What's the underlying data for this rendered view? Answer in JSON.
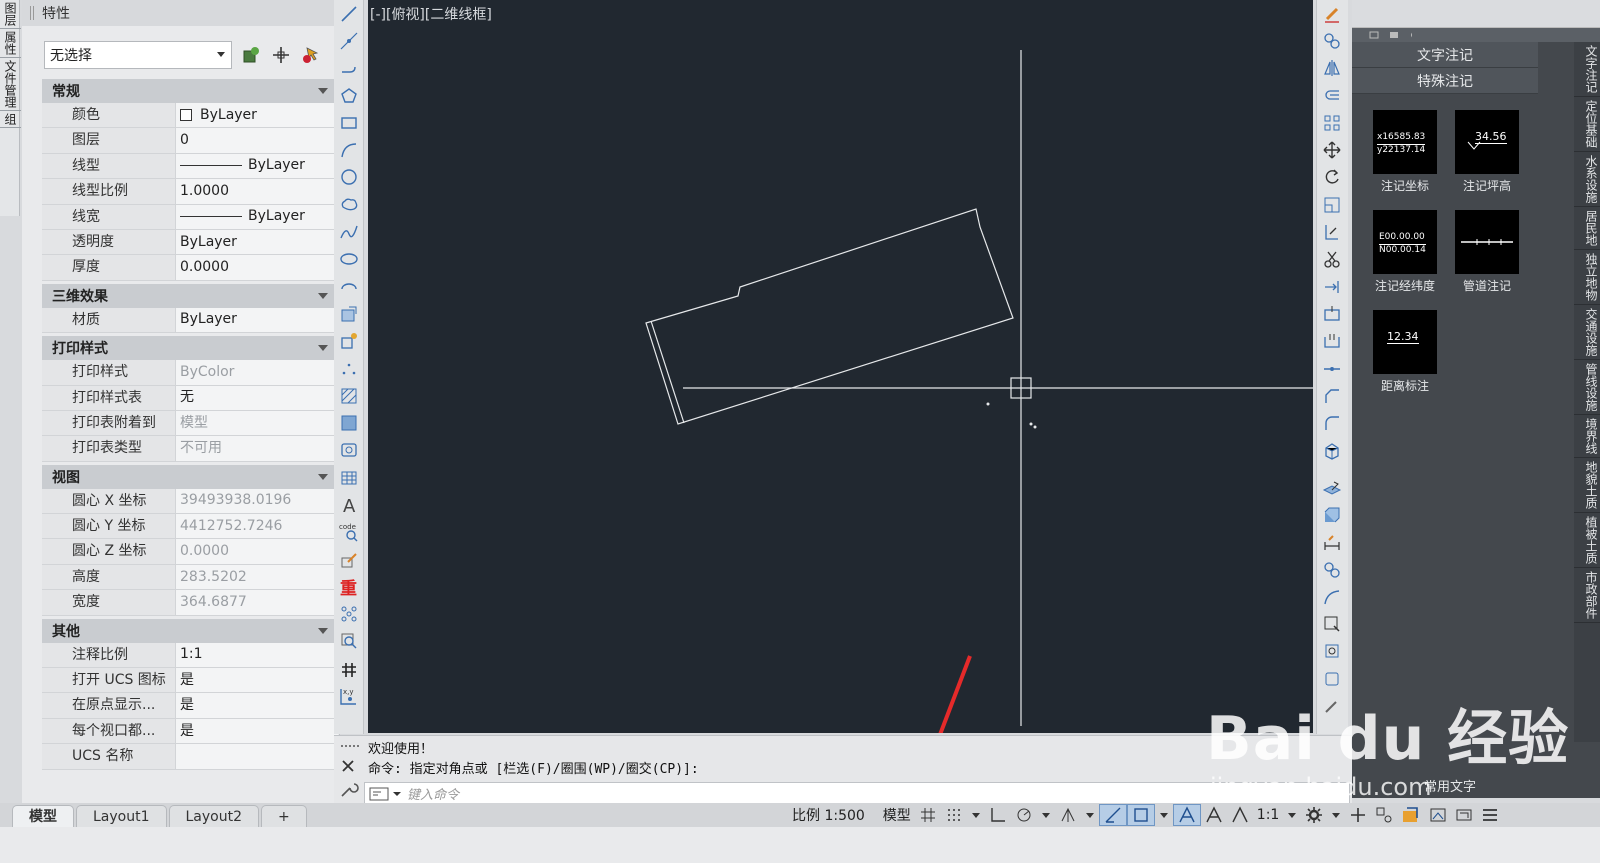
{
  "left_strip": {
    "tabs": [
      "图层",
      "属性",
      "文件管理",
      "组"
    ]
  },
  "properties": {
    "title": "特性",
    "selection": "无选择",
    "sections": [
      {
        "name": "常规",
        "rows": [
          {
            "label": "颜色",
            "value": "ByLayer",
            "kind": "color"
          },
          {
            "label": "图层",
            "value": "0"
          },
          {
            "label": "线型",
            "value": "ByLayer",
            "kind": "line"
          },
          {
            "label": "线型比例",
            "value": "1.0000"
          },
          {
            "label": "线宽",
            "value": "ByLayer",
            "kind": "line"
          },
          {
            "label": "透明度",
            "value": "ByLayer"
          },
          {
            "label": "厚度",
            "value": "0.0000"
          }
        ]
      },
      {
        "name": "三维效果",
        "rows": [
          {
            "label": "材质",
            "value": "ByLayer"
          }
        ]
      },
      {
        "name": "打印样式",
        "rows": [
          {
            "label": "打印样式",
            "value": "ByColor",
            "gray": true
          },
          {
            "label": "打印样式表",
            "value": "无"
          },
          {
            "label": "打印表附着到",
            "value": "模型",
            "gray": true
          },
          {
            "label": "打印表类型",
            "value": "不可用",
            "gray": true
          }
        ]
      },
      {
        "name": "视图",
        "rows": [
          {
            "label": "圆心 X 坐标",
            "value": "39493938.0196",
            "gray": true
          },
          {
            "label": "圆心 Y 坐标",
            "value": "4412752.7246",
            "gray": true
          },
          {
            "label": "圆心 Z 坐标",
            "value": "0.0000",
            "gray": true
          },
          {
            "label": "高度",
            "value": "283.5202",
            "gray": true
          },
          {
            "label": "宽度",
            "value": "364.6877",
            "gray": true
          }
        ]
      },
      {
        "name": "其他",
        "rows": [
          {
            "label": "注释比例",
            "value": "1:1"
          },
          {
            "label": "打开 UCS 图标",
            "value": "是"
          },
          {
            "label": "在原点显示...",
            "value": "是"
          },
          {
            "label": "每个视口都...",
            "value": "是"
          },
          {
            "label": "UCS 名称",
            "value": ""
          }
        ]
      }
    ]
  },
  "viewport": {
    "label": "[-][俯视][二维线框]"
  },
  "palette": {
    "heads": [
      "文字注记",
      "特殊注记"
    ],
    "tools": [
      {
        "label": "注记坐标",
        "thumb1": "x16585.83",
        "thumb2": "y22137.14"
      },
      {
        "label": "注记坪高",
        "thumb1": "34.56",
        "thumb2": ""
      },
      {
        "label": "注记经纬度",
        "thumb1": "E00.00.00",
        "thumb2": "N00.00.14"
      },
      {
        "label": "管道注记",
        "thumb1": "",
        "thumb2": ""
      },
      {
        "label": "距离标注",
        "thumb1": "12.34",
        "thumb2": ""
      }
    ],
    "bottom_label": "常用文字",
    "vtabs": [
      "文字注记",
      "定位基础",
      "水系设施",
      "居民地",
      "独立地物",
      "交通设施",
      "管线设施",
      "境界线",
      "地貌土质",
      "植被土质",
      "市政部件"
    ]
  },
  "command": {
    "line1": "欢迎使用！",
    "line2": "命令: 指定对角点或 [栏选(F)/圈围(WP)/圈交(CP)]:",
    "placeholder": "键入命令"
  },
  "layout_tabs": [
    "模型",
    "Layout1",
    "Layout2",
    "+"
  ],
  "status": {
    "scale": "比例 1:500",
    "model": "模型",
    "anno_scale": "1:1"
  },
  "watermark": {
    "main": "Bai du 经验",
    "sub": "jingyan.baidu.com"
  }
}
